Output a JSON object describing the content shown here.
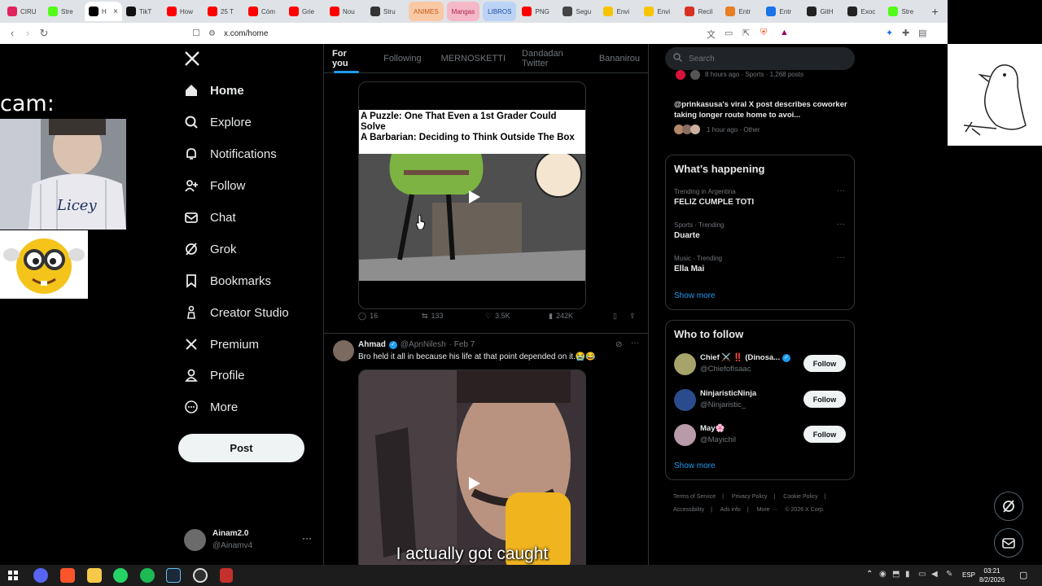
{
  "browser": {
    "tabs": [
      {
        "label": "CIRU",
        "color": "#e0245e"
      },
      {
        "label": "Stre",
        "color": "#53fc18"
      },
      {
        "label": "H",
        "color": "#000000",
        "active": true
      },
      {
        "label": "TikT",
        "color": "#111111"
      },
      {
        "label": "How",
        "color": "#ff0000"
      },
      {
        "label": "25 T",
        "color": "#ff0000"
      },
      {
        "label": "Cóm",
        "color": "#ff0000"
      },
      {
        "label": "Grie",
        "color": "#ff0000"
      },
      {
        "label": "Nou",
        "color": "#ff0000"
      },
      {
        "label": "Stru",
        "color": "#333333"
      }
    ],
    "colored_tabs": [
      {
        "label": "ANIMES",
        "bg": "#f9c9a5",
        "fg": "#c75a1c"
      },
      {
        "label": "Mangas",
        "bg": "#f4b8c9",
        "fg": "#b0244d"
      },
      {
        "label": "LIBROS",
        "bg": "#bcd3f5",
        "fg": "#1d4ea8"
      }
    ],
    "tabs2": [
      {
        "label": "PNG",
        "color": "#ff0000"
      },
      {
        "label": "Segu",
        "color": "#444444"
      },
      {
        "label": "Envi",
        "color": "#f6c400"
      },
      {
        "label": "Envi",
        "color": "#f6c400"
      },
      {
        "label": "Recil",
        "color": "#d93025"
      },
      {
        "label": "Entr",
        "color": "#e67e22"
      },
      {
        "label": "Entr",
        "color": "#1a73e8"
      },
      {
        "label": "GitH",
        "color": "#222222"
      },
      {
        "label": "Exoc",
        "color": "#222222"
      },
      {
        "label": "Stre",
        "color": "#53fc18"
      }
    ],
    "new_tab": "+",
    "url": "x.com/home"
  },
  "overlays": {
    "cam_label": "cam:"
  },
  "sidebar": {
    "items": [
      {
        "label": "Home",
        "icon": "home-icon",
        "bold": true
      },
      {
        "label": "Explore",
        "icon": "search-icon"
      },
      {
        "label": "Notifications",
        "icon": "bell-icon"
      },
      {
        "label": "Follow",
        "icon": "person-plus-icon"
      },
      {
        "label": "Chat",
        "icon": "mail-icon"
      },
      {
        "label": "Grok",
        "icon": "grok-icon"
      },
      {
        "label": "Bookmarks",
        "icon": "bookmark-icon"
      },
      {
        "label": "Creator Studio",
        "icon": "creator-icon"
      },
      {
        "label": "Premium",
        "icon": "x-logo-icon"
      },
      {
        "label": "Profile",
        "icon": "person-icon"
      },
      {
        "label": "More",
        "icon": "more-circle-icon"
      }
    ],
    "post_button": "Post",
    "account": {
      "name": "Ainam2.0",
      "handle": "@Ainamv4"
    }
  },
  "feed": {
    "tabs": [
      "For you",
      "Following",
      "MERNOSKETTI",
      "Dandadan Twitter",
      "Bananirou"
    ],
    "post1": {
      "caption_line1": "A Puzzle: One That Even a 1st Grader Could Solve",
      "caption_line2": "A Barbarian: Deciding to Think Outside The Box",
      "replies": "16",
      "reposts": "133",
      "likes": "3.5K",
      "views": "242K"
    },
    "post2": {
      "name": "Ahmad",
      "handle": "@ApnNilesh",
      "date": "· Feb 7",
      "text": "Bro held it all in because his life at that point depended on it.😭😂",
      "video_subtitle": "I actually got caught"
    }
  },
  "right": {
    "search_placeholder": "Search",
    "top_item": {
      "meta": "8 hours ago · Sports · 1,268 posts"
    },
    "news": {
      "title": "@prinkasusa's viral X post describes coworker taking longer route home to avoi...",
      "meta": "1 hour ago · Other"
    },
    "happening": {
      "title": "What’s happening",
      "trends": [
        {
          "meta": "Trending in Argentina",
          "name": "FELIZ CUMPLE TOTI"
        },
        {
          "meta": "Sports · Trending",
          "name": "Duarte"
        },
        {
          "meta": "Music · Trending",
          "name": "Ella Mai"
        }
      ],
      "show_more": "Show more"
    },
    "who_to_follow": {
      "title": "Who to follow",
      "users": [
        {
          "name": "Chief ⚔️ ‼️ (Dinosa...",
          "handle": "@ChiefofIsaac",
          "button": "Follow"
        },
        {
          "name": "NinjaristicNinja",
          "handle": "@Ninjaristic_",
          "button": "Follow"
        },
        {
          "name": "May🌸",
          "handle": "@Mayichil",
          "button": "Follow"
        }
      ],
      "show_more": "Show more"
    },
    "footer": [
      "Terms of Service",
      "|",
      "Privacy Policy",
      "|",
      "Cookie Policy",
      "|",
      "Accessibility",
      "|",
      "Ads info",
      "|",
      "More ···",
      "© 2026 X Corp."
    ]
  },
  "taskbar": {
    "lang": "ESP",
    "time": "03:21",
    "date": "8/2/2026"
  }
}
